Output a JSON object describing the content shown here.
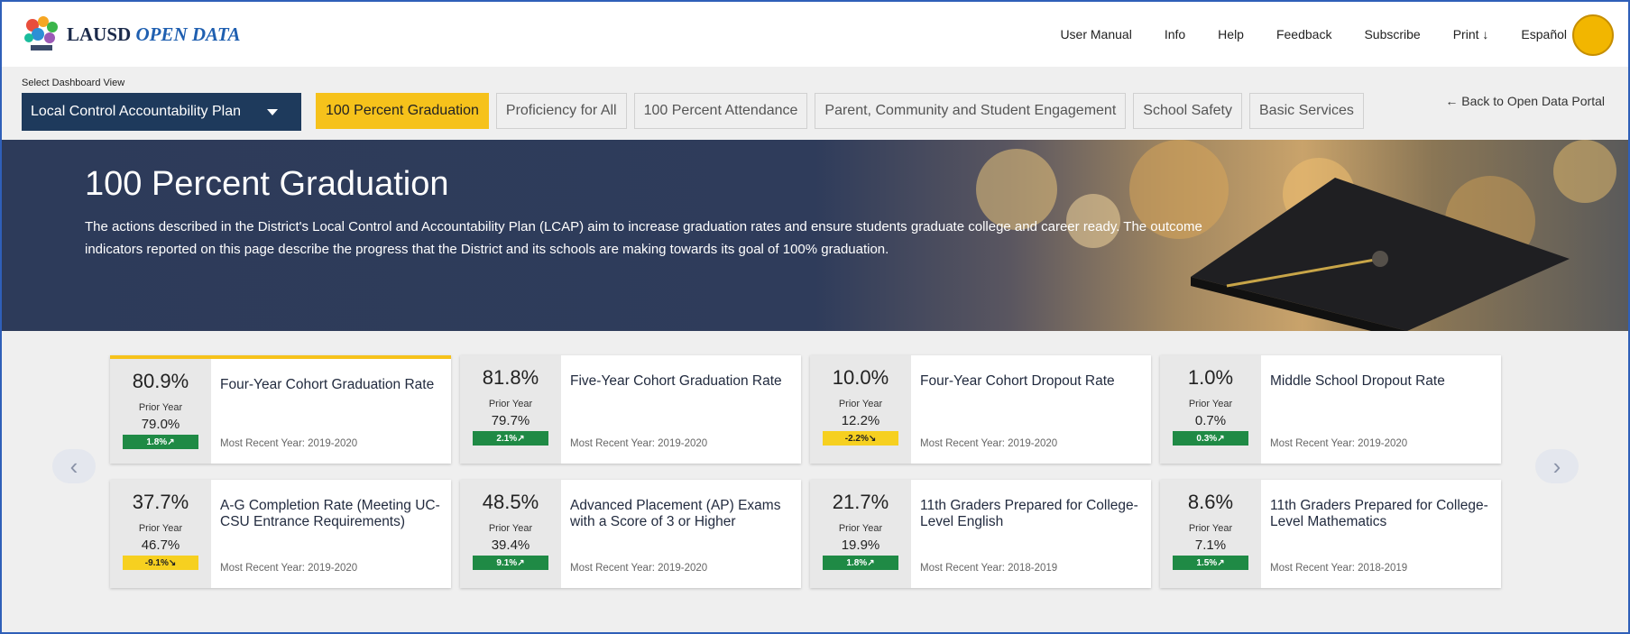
{
  "header": {
    "brand_prefix": "LAUSD",
    "brand_accent": "OPEN DATA",
    "nav": [
      "User Manual",
      "Info",
      "Help",
      "Feedback",
      "Subscribe",
      "Print ↓",
      "Español"
    ]
  },
  "view_select": {
    "label": "Select Dashboard View",
    "value": "Local Control Accountability Plan"
  },
  "tabs": [
    {
      "label": "100 Percent Graduation",
      "active": true
    },
    {
      "label": "Proficiency for All",
      "active": false
    },
    {
      "label": "100 Percent Attendance",
      "active": false
    },
    {
      "label": "Parent, Community and Student Engagement",
      "active": false
    },
    {
      "label": "School Safety",
      "active": false
    },
    {
      "label": "Basic Services",
      "active": false
    }
  ],
  "back_link": "Back to Open Data Portal",
  "hero": {
    "title": "100 Percent Graduation",
    "text": "The actions described in the District's Local Control and Accountability Plan (LCAP) aim to increase graduation rates and ensure students graduate college and career ready. The outcome indicators reported on this page describe the progress that the District and its schools are making towards its goal of 100% graduation."
  },
  "carousel": {
    "prev": "‹",
    "next": "›"
  },
  "cards": [
    {
      "value": "80.9%",
      "prior_label": "Prior Year",
      "prior": "79.0%",
      "change": "1.8%↗",
      "change_color": "green",
      "title": "Four-Year Cohort Graduation Rate",
      "year": "Most Recent Year: 2019-2020"
    },
    {
      "value": "81.8%",
      "prior_label": "Prior Year",
      "prior": "79.7%",
      "change": "2.1%↗",
      "change_color": "green",
      "title": "Five-Year Cohort Graduation Rate",
      "year": "Most Recent Year: 2019-2020"
    },
    {
      "value": "10.0%",
      "prior_label": "Prior Year",
      "prior": "12.2%",
      "change": "-2.2%↘",
      "change_color": "yellow",
      "title": "Four-Year Cohort Dropout Rate",
      "year": "Most Recent Year: 2019-2020"
    },
    {
      "value": "1.0%",
      "prior_label": "Prior Year",
      "prior": "0.7%",
      "change": "0.3%↗",
      "change_color": "green",
      "title": "Middle School Dropout Rate",
      "year": "Most Recent Year: 2019-2020"
    },
    {
      "value": "37.7%",
      "prior_label": "Prior Year",
      "prior": "46.7%",
      "change": "-9.1%↘",
      "change_color": "yellow",
      "title": "A-G Completion Rate (Meeting UC-CSU Entrance Requirements)",
      "year": "Most Recent Year: 2019-2020"
    },
    {
      "value": "48.5%",
      "prior_label": "Prior Year",
      "prior": "39.4%",
      "change": "9.1%↗",
      "change_color": "green",
      "title": "Advanced Placement (AP) Exams with a Score of 3 or Higher",
      "year": "Most Recent Year: 2019-2020"
    },
    {
      "value": "21.7%",
      "prior_label": "Prior Year",
      "prior": "19.9%",
      "change": "1.8%↗",
      "change_color": "green",
      "title": "11th Graders Prepared for College-Level English",
      "year": "Most Recent Year: 2018-2019"
    },
    {
      "value": "8.6%",
      "prior_label": "Prior Year",
      "prior": "7.1%",
      "change": "1.5%↗",
      "change_color": "green",
      "title": "11th Graders Prepared for College-Level Mathematics",
      "year": "Most Recent Year: 2018-2019"
    }
  ]
}
